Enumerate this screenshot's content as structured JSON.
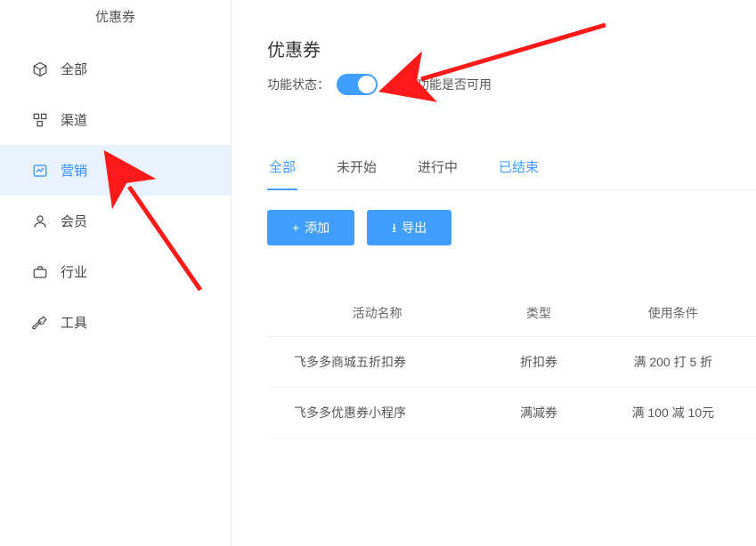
{
  "sidebar": {
    "title": "优惠券",
    "items": [
      {
        "label": "全部"
      },
      {
        "label": "渠道"
      },
      {
        "label": "营销"
      },
      {
        "label": "会员"
      },
      {
        "label": "行业"
      },
      {
        "label": "工具"
      }
    ]
  },
  "header": {
    "title": "优惠券",
    "toggle_label": "功能状态：",
    "toggle_desc": "控制功能是否可用",
    "toggle_on": true
  },
  "tabs": [
    {
      "label": "全部",
      "active": true
    },
    {
      "label": "未开始"
    },
    {
      "label": "进行中"
    },
    {
      "label": "已结束"
    }
  ],
  "buttons": {
    "add": "添加",
    "export": "导出"
  },
  "table": {
    "headers": [
      "活动名称",
      "类型",
      "使用条件"
    ],
    "rows": [
      {
        "name": "飞多多商城五折扣券",
        "type": "折扣券",
        "cond": "满 200 打 5 折"
      },
      {
        "name": "飞多多优惠券小程序",
        "type": "满减券",
        "cond": "满 100 减 10元"
      }
    ]
  }
}
